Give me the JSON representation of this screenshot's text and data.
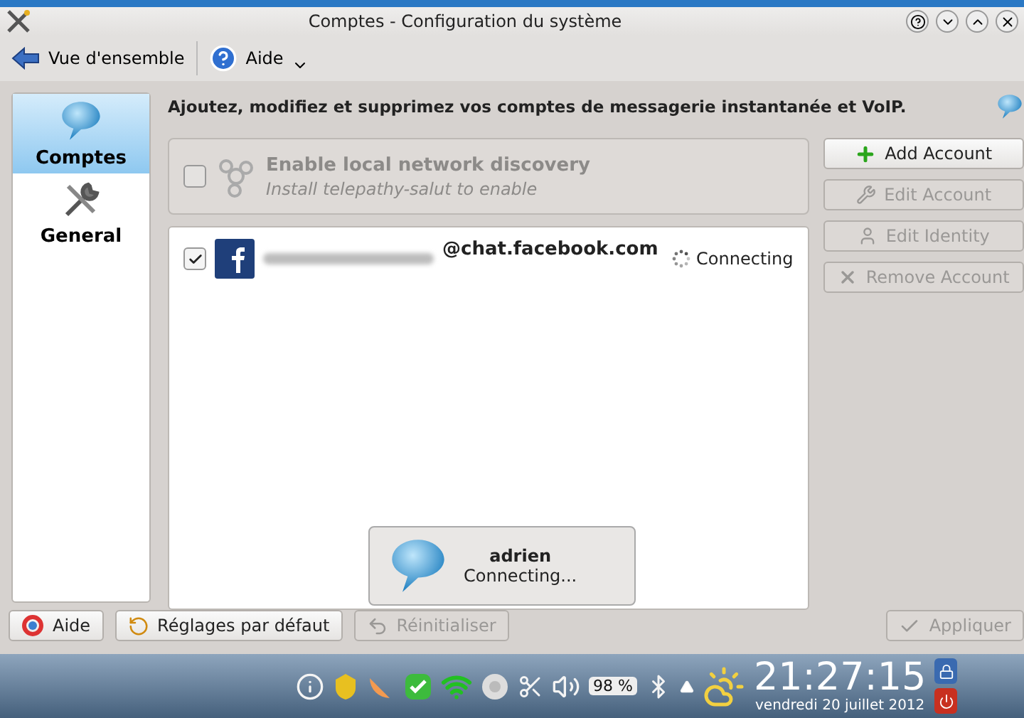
{
  "window": {
    "title": "Comptes - Configuration du système"
  },
  "toolbar": {
    "back": "Vue d'ensemble",
    "help": "Aide"
  },
  "sidebar": {
    "items": [
      {
        "label": "Comptes",
        "selected": true,
        "kind": "bubble"
      },
      {
        "label": "General",
        "selected": false,
        "kind": "tools"
      }
    ]
  },
  "header": "Ajoutez, modifiez et supprimez vos comptes de messagerie instantanée et VoIP.",
  "discovery": {
    "title": "Enable local network discovery",
    "subtitle": "Install telepathy-salut to enable",
    "checked": false,
    "disabled": true
  },
  "accounts": [
    {
      "address": "@chat.facebook.com",
      "status": "Connecting",
      "checked": true
    }
  ],
  "actions": [
    {
      "label": "Add Account",
      "kind": "add",
      "disabled": false
    },
    {
      "label": "Edit Account",
      "kind": "edit",
      "disabled": true
    },
    {
      "label": "Edit Identity",
      "kind": "identity",
      "disabled": true
    },
    {
      "label": "Remove Account",
      "kind": "remove",
      "disabled": true
    }
  ],
  "footer": [
    {
      "label": "Aide",
      "kind": "help",
      "disabled": false
    },
    {
      "label": "Réglages par défaut",
      "kind": "defaults",
      "disabled": false
    },
    {
      "label": "Réinitialiser",
      "kind": "reset",
      "disabled": true
    },
    {
      "label": "Appliquer",
      "kind": "apply",
      "disabled": true
    }
  ],
  "notification": {
    "title": "adrien",
    "message": "Connecting..."
  },
  "taskbar": {
    "battery": "98 %",
    "time": "21:27:15",
    "date": "vendredi 20 juillet 2012"
  }
}
